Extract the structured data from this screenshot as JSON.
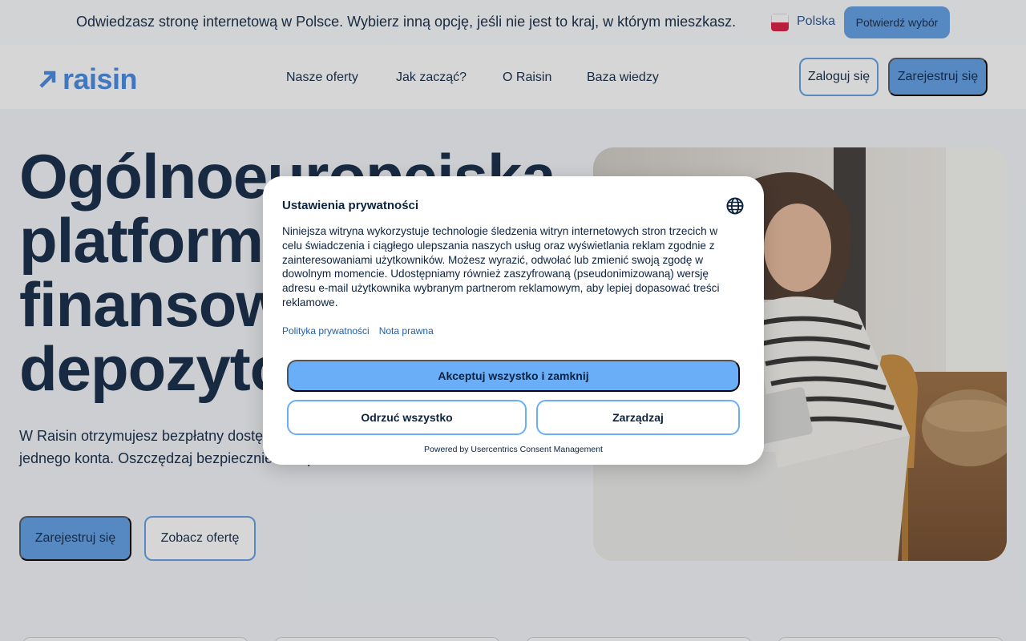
{
  "country_banner": {
    "message": "Odwiedzasz stronę internetową w Polsce. Wybierz inną opcję, jeśli nie jest to kraj, w którym mieszkasz.",
    "country_name": "Polska",
    "confirm_label": "Potwierdź wybór"
  },
  "header": {
    "logo_text": "raisin",
    "nav": [
      {
        "label": "Nasze oferty"
      },
      {
        "label": "Jak zacząć?"
      },
      {
        "label": "O Raisin"
      },
      {
        "label": "Baza wiedzy"
      }
    ],
    "login_label": "Zaloguj się",
    "register_label": "Zarejestruj się"
  },
  "hero": {
    "title_lines": [
      "Ogólnoeuropejska",
      "platforma",
      "finansowa",
      "depozytów"
    ],
    "description": "W Raisin otrzymujesz bezpłatny dostęp do ofert lokat z całej Europy za pomocą jednego konta. Oszczędzaj bezpiecznie i bezproblemowo.",
    "primary_button": "Zarejestruj się",
    "secondary_button": "Zobacz ofertę"
  },
  "consent": {
    "title": "Ustawienia prywatności",
    "body": "Niniejsza witryna wykorzystuje technologie śledzenia witryn internetowych stron trzecich w celu świadczenia i ciągłego ulepszania naszych usług oraz wyświetlania reklam zgodnie z zainteresowaniami użytkowników. Możesz wyrazić, odwołać lub zmienić swoją zgodę w dowolnym momencie. Udostępniamy również zaszyfrowaną (pseudonimizowaną) wersję adresu e-mail użytkownika wybranym partnerom reklamowym, aby lepiej dopasować treści reklamowe.",
    "links": [
      "Polityka prywatności",
      "Nota prawna"
    ],
    "accept_label": "Akceptuj wszystko i zamknij",
    "deny_label": "Odrzuć wszystko",
    "manage_label": "Zarządzaj",
    "powered_by": "Powered by Usercentrics Consent Management"
  },
  "colors": {
    "brand": "#3f86e0",
    "button": "#5c9be6",
    "accept": "#6aaef7",
    "text": "#0c2340"
  }
}
